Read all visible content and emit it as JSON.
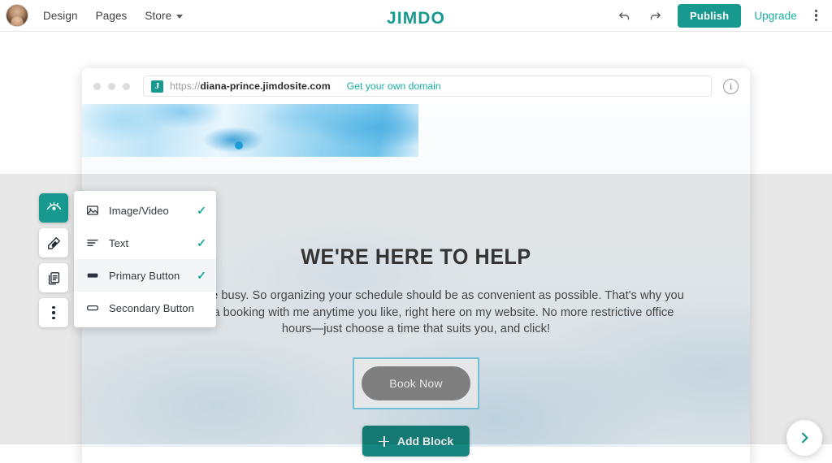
{
  "topbar": {
    "avatar_name": "user-avatar",
    "nav": [
      {
        "label": "Design",
        "has_caret": false
      },
      {
        "label": "Pages",
        "has_caret": false
      },
      {
        "label": "Store",
        "has_caret": true
      }
    ],
    "logo": "JIMDO",
    "undo_icon": "undo-arrow-icon",
    "redo_icon": "redo-arrow-icon",
    "publish_label": "Publish",
    "upgrade_label": "Upgrade",
    "overflow_icon": "kebab-menu-icon"
  },
  "browser": {
    "scheme": "https://",
    "domain": "diana-prince.jimdosite.com",
    "cta": "Get your own domain",
    "info_icon": "info-circle-icon",
    "favicon_letter": "J"
  },
  "site": {
    "heading": "WE'RE HERE TO HELP",
    "paragraph": "I know you're busy. So organizing your schedule should be as convenient as possible. That's why you can make a booking with me anytime you like, right here on my website. No more restrictive office hours—just choose a time that suits you, and click!",
    "book_button": "Book Now",
    "add_block": "Add Block"
  },
  "rail": {
    "items": [
      {
        "name": "preview-eye-icon",
        "active": true
      },
      {
        "name": "paint-style-icon",
        "active": false
      },
      {
        "name": "copy-duplicate-icon",
        "active": false
      },
      {
        "name": "more-options-icon",
        "active": false
      }
    ]
  },
  "dropdown": {
    "items": [
      {
        "label": "Image/Video",
        "icon": "image-icon",
        "checked": true,
        "selected": false
      },
      {
        "label": "Text",
        "icon": "text-lines-icon",
        "checked": true,
        "selected": false
      },
      {
        "label": "Primary Button",
        "icon": "filled-button-icon",
        "checked": true,
        "selected": true
      },
      {
        "label": "Secondary Button",
        "icon": "outlined-button-icon",
        "checked": false,
        "selected": false
      }
    ],
    "check_glyph": "✓"
  },
  "fab": {
    "icon": "chevron-right-icon"
  },
  "colors": {
    "teal": "#17998f",
    "teal_light": "#18b09f",
    "check_teal": "#17a9a0",
    "selection_blue": "#7fd2ee",
    "button_gray": "#8c8c8c",
    "add_block_teal": "#17857f"
  }
}
